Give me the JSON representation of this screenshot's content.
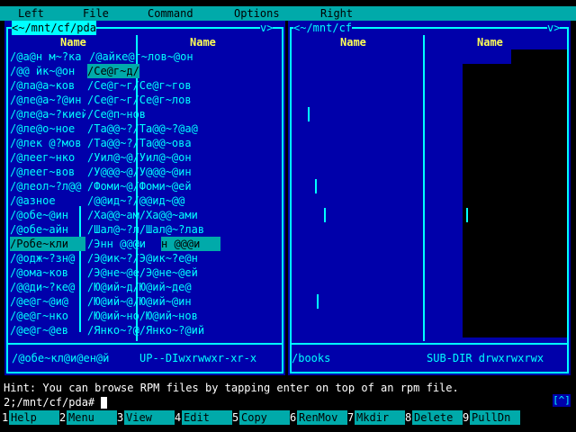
{
  "menu": [
    "Left",
    "File",
    "Command",
    "Options",
    "Right"
  ],
  "left_panel": {
    "title": "<~/mnt/cf/pda",
    "sort_indicator": "v>",
    "col_headers": [
      "Name",
      "Name"
    ],
    "rows": [
      [
        "/@a@н м~?ка",
        "/@айке@г~лов~@он"
      ],
      [
        "/@@ йк~@он",
        "/Се@г~д/Се@г~дов"
      ],
      [
        "/@ла@а~ков",
        "/Се@г~г/Се@г~гов"
      ],
      [
        "/@ле@а~?@ин",
        "/Се@г~г/Се@г~лов"
      ],
      [
        "/@ле@а~?киейа@и@еп",
        "/Се@п~нов"
      ],
      [
        "/@ле@о~ное",
        "/Та@@~?/Та@@~?@а@"
      ],
      [
        "/@лек @?мов",
        "/Та@@~?/Та@@~ова"
      ],
      [
        "/@леег~нко",
        "/Уил@~@/Уил@~@он"
      ],
      [
        "/@леег~вов",
        "/У@@@~@/У@@@~@ин"
      ],
      [
        "/@леол~?л@@",
        "/Фоми~@/Фоми~@ей"
      ],
      [
        "/@азное",
        "/@@ид~?/@@ид~@@"
      ],
      [
        "/@обе~@ин",
        "/Ха@@~ам/Ха@@~ами"
      ],
      [
        "/@обе~айн",
        "/Шал@~?л/Шал@~?лав"
      ],
      [
        "/Робе~кли",
        "/Энн @@@и",
        "н @@@и"
      ],
      [
        "/@одж~?зн@",
        "/Э@ик~?/Э@ик~?е@н"
      ],
      [
        "/@ома~ков",
        "/Э@не~@е/Э@не~@ей"
      ],
      [
        "/@@ди~?ке@",
        "/Ю@ий~д/Ю@ий~де@"
      ],
      [
        "/@е@г~@и@",
        "/Ю@ий~@/Ю@ий~@ин"
      ],
      [
        "/@е@г~нко",
        "/Ю@ий~но/Ю@ий~нов"
      ],
      [
        "/@е@г~@ев",
        "/Янко~?@/Янко~?@ий"
      ]
    ],
    "status_name": "/@обе~кл@и@ен@й",
    "status_info": "UP--DIwxrwwxr-xr-x"
  },
  "right_panel": {
    "title": "<~/mnt/cf",
    "sort_indicator": "v>",
    "col_headers": [
      "Name",
      "Name"
    ],
    "status_name": "/books",
    "status_info": "SUB-DIR drwxrwxrwx"
  },
  "hint": "Hint: You can browse RPM files by tapping enter on top of an rpm file.",
  "prompt": "2;/mnt/cf/pda# ",
  "corner_button": "[^]",
  "fkeys": [
    {
      "num": "1",
      "label": "Help"
    },
    {
      "num": "2",
      "label": "Menu"
    },
    {
      "num": "3",
      "label": "View"
    },
    {
      "num": "4",
      "label": "Edit"
    },
    {
      "num": "5",
      "label": "Copy"
    },
    {
      "num": "6",
      "label": "RenMov"
    },
    {
      "num": "7",
      "label": "Mkdir"
    },
    {
      "num": "8",
      "label": "Delete"
    },
    {
      "num": "9",
      "label": "PullDn"
    }
  ],
  "colors": {
    "panel_bg": "#0000aa",
    "panel_fg": "#00ffff",
    "header_fg": "#ffff55",
    "menu_bg": "#00aaaa",
    "selection_bg": "#00aaaa"
  }
}
